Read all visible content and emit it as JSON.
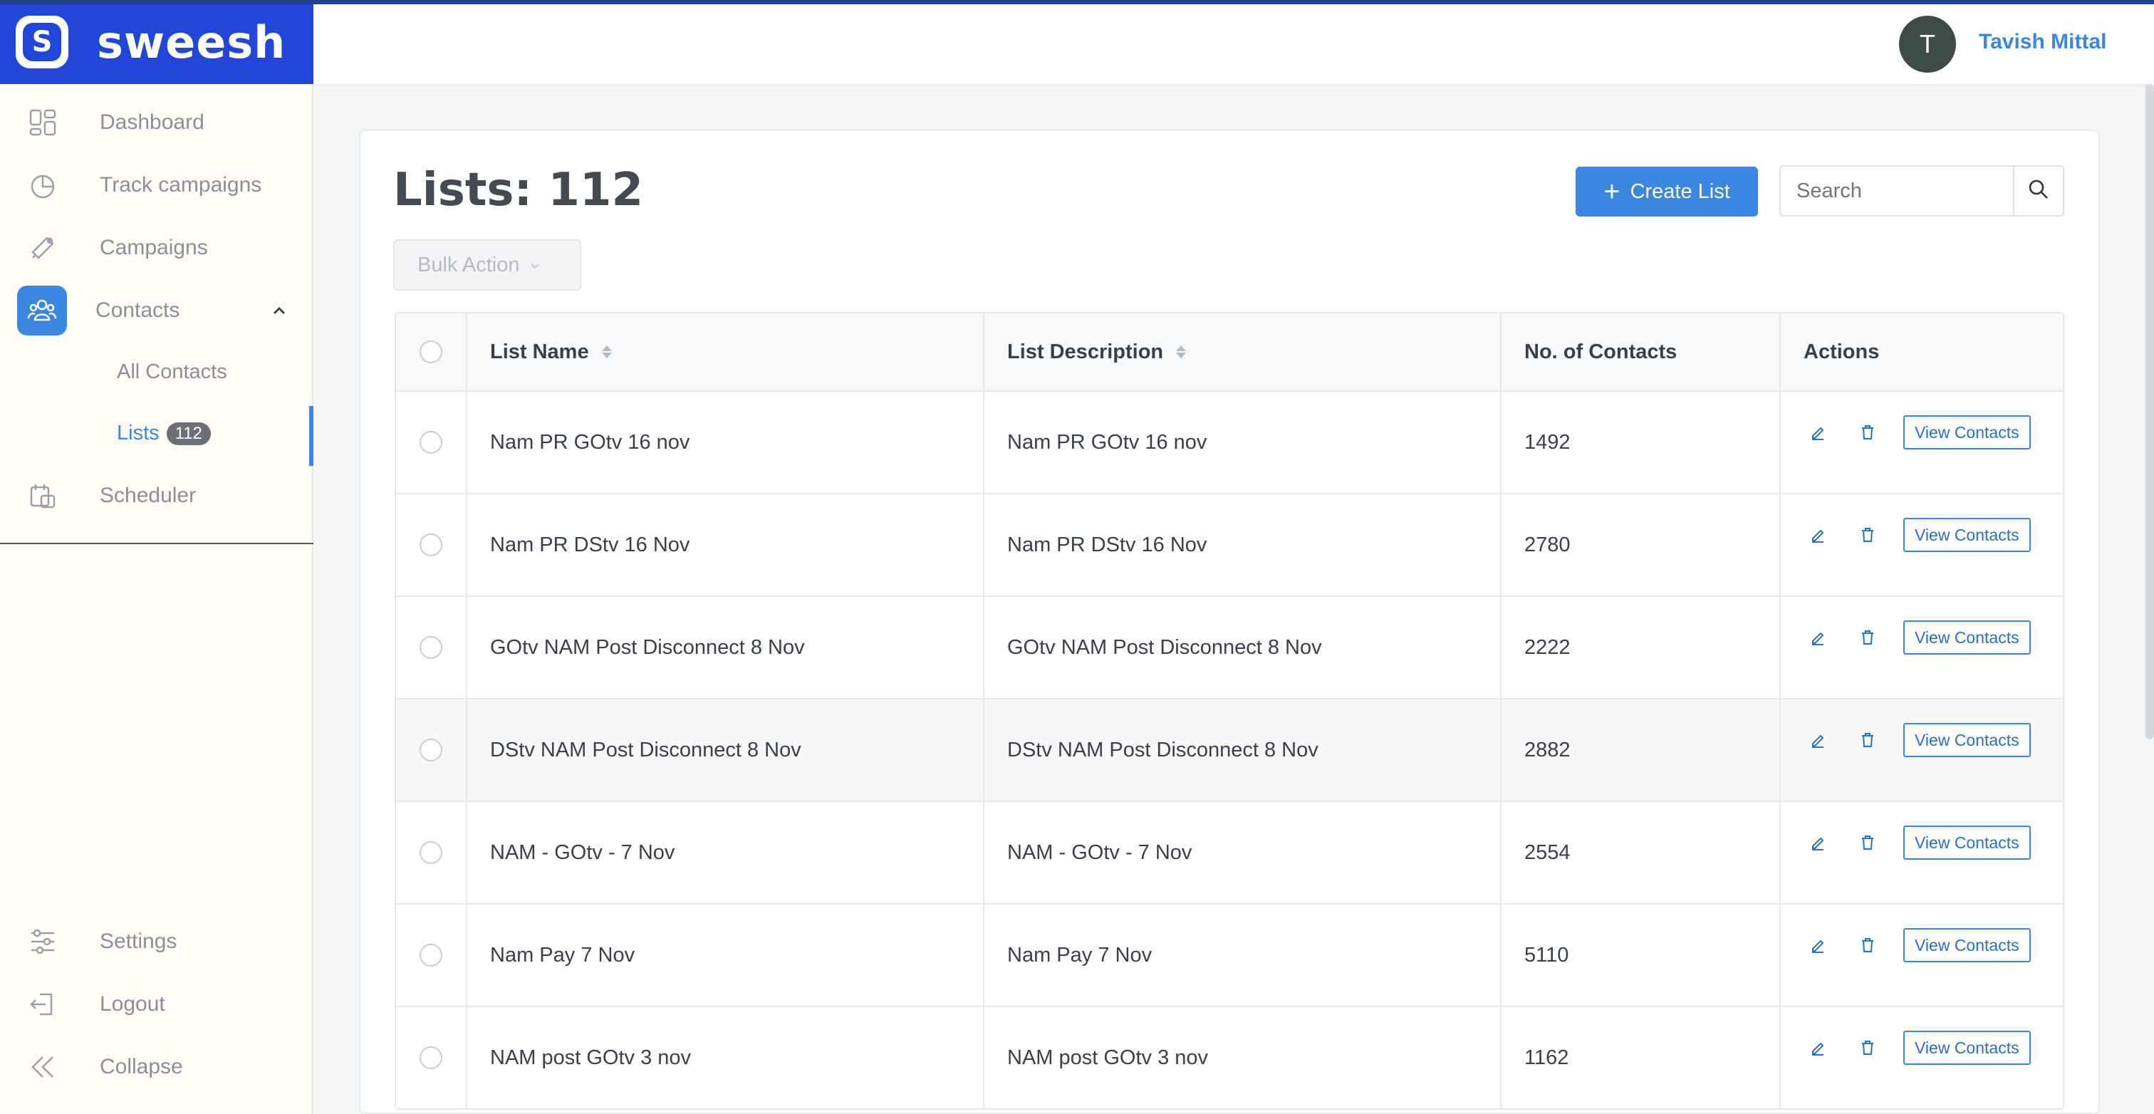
{
  "brand": {
    "name": "sweesh",
    "logo_letter": "S"
  },
  "sidebar": {
    "items": [
      {
        "label": "Dashboard",
        "icon": "dashboard-icon"
      },
      {
        "label": "Track campaigns",
        "icon": "pie-chart-icon"
      },
      {
        "label": "Campaigns",
        "icon": "megaphone-icon"
      },
      {
        "label": "Contacts",
        "icon": "users-icon"
      },
      {
        "label": "Scheduler",
        "icon": "calendar-icon"
      }
    ],
    "sub_items": [
      {
        "label": "All Contacts"
      },
      {
        "label": "Lists",
        "badge": "112"
      }
    ],
    "bottom": [
      {
        "label": "Settings",
        "icon": "sliders-icon"
      },
      {
        "label": "Logout",
        "icon": "logout-icon"
      },
      {
        "label": "Collapse",
        "icon": "collapse-icon"
      }
    ]
  },
  "header": {
    "avatar_letter": "T",
    "user_name": "Tavish Mittal"
  },
  "main": {
    "title": "Lists: 112",
    "create_label": "Create List",
    "search_placeholder": "Search",
    "bulk_label": "Bulk Action"
  },
  "table": {
    "columns": [
      "List Name",
      "List Description",
      "No. of Contacts",
      "Actions"
    ],
    "view_label": "View Contacts",
    "rows": [
      {
        "name": "Nam PR GOtv 16 nov",
        "description": "Nam PR GOtv 16 nov",
        "count": "1492"
      },
      {
        "name": "Nam PR DStv 16 Nov",
        "description": "Nam PR DStv 16 Nov",
        "count": "2780"
      },
      {
        "name": "GOtv NAM Post Disconnect 8 Nov",
        "description": "GOtv NAM Post Disconnect 8 Nov",
        "count": "2222"
      },
      {
        "name": "DStv NAM Post Disconnect 8 Nov",
        "description": "DStv NAM Post Disconnect 8 Nov",
        "count": "2882"
      },
      {
        "name": "NAM - GOtv - 7 Nov",
        "description": "NAM - GOtv - 7 Nov",
        "count": "2554"
      },
      {
        "name": "Nam Pay 7 Nov",
        "description": "Nam Pay 7 Nov",
        "count": "5110"
      },
      {
        "name": "NAM post GOtv 3 nov",
        "description": "NAM post GOtv 3 nov",
        "count": "1162"
      }
    ]
  },
  "colors": {
    "brand": "#2146d8",
    "accent": "#3b86e0"
  }
}
